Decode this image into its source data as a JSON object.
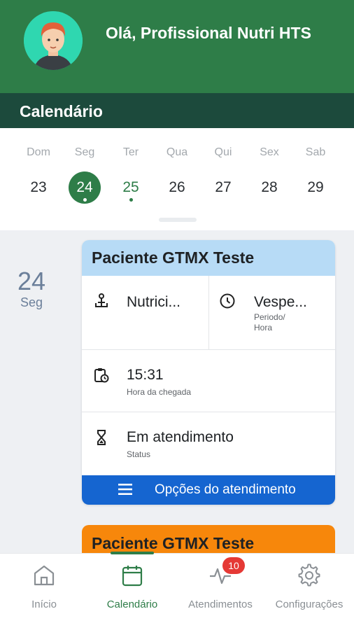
{
  "header": {
    "greeting": "Olá, Profissional Nutri HTS",
    "avatar_icon": "user-avatar-illustration",
    "colors": {
      "header_bg": "#2e7d48",
      "subheader_bg": "#1c4a3c"
    }
  },
  "section_title": "Calendário",
  "week": {
    "days": [
      {
        "dow": "Dom",
        "num": "23"
      },
      {
        "dow": "Seg",
        "num": "24"
      },
      {
        "dow": "Ter",
        "num": "25"
      },
      {
        "dow": "Qua",
        "num": "26"
      },
      {
        "dow": "Qui",
        "num": "27"
      },
      {
        "dow": "Sex",
        "num": "28"
      },
      {
        "dow": "Sab",
        "num": "29"
      }
    ],
    "selected_index": 1,
    "marked_indices": [
      1,
      2
    ]
  },
  "selected_date": {
    "num": "24",
    "dow": "Seg"
  },
  "appointments": [
    {
      "patient": "Paciente GTMX Teste",
      "header_color": "#b7dbf6",
      "type_value": "Nutrici...",
      "period_value": "Vespe...",
      "period_label_1": "Periodo/",
      "period_label_2": "Hora",
      "arrival_value": "15:31",
      "arrival_label": "Hora da chegada",
      "status_value": "Em atendimento",
      "status_label": "Status",
      "options_label": "Opções do atendimento"
    },
    {
      "patient": "Paciente GTMX Teste",
      "header_color": "#f7870b"
    }
  ],
  "nav": {
    "items": [
      {
        "label": "Início",
        "icon": "home-icon"
      },
      {
        "label": "Calendário",
        "icon": "calendar-icon"
      },
      {
        "label": "Atendimentos",
        "icon": "activity-icon",
        "badge": "10"
      },
      {
        "label": "Configurações",
        "icon": "gear-icon"
      }
    ],
    "active_index": 1
  }
}
